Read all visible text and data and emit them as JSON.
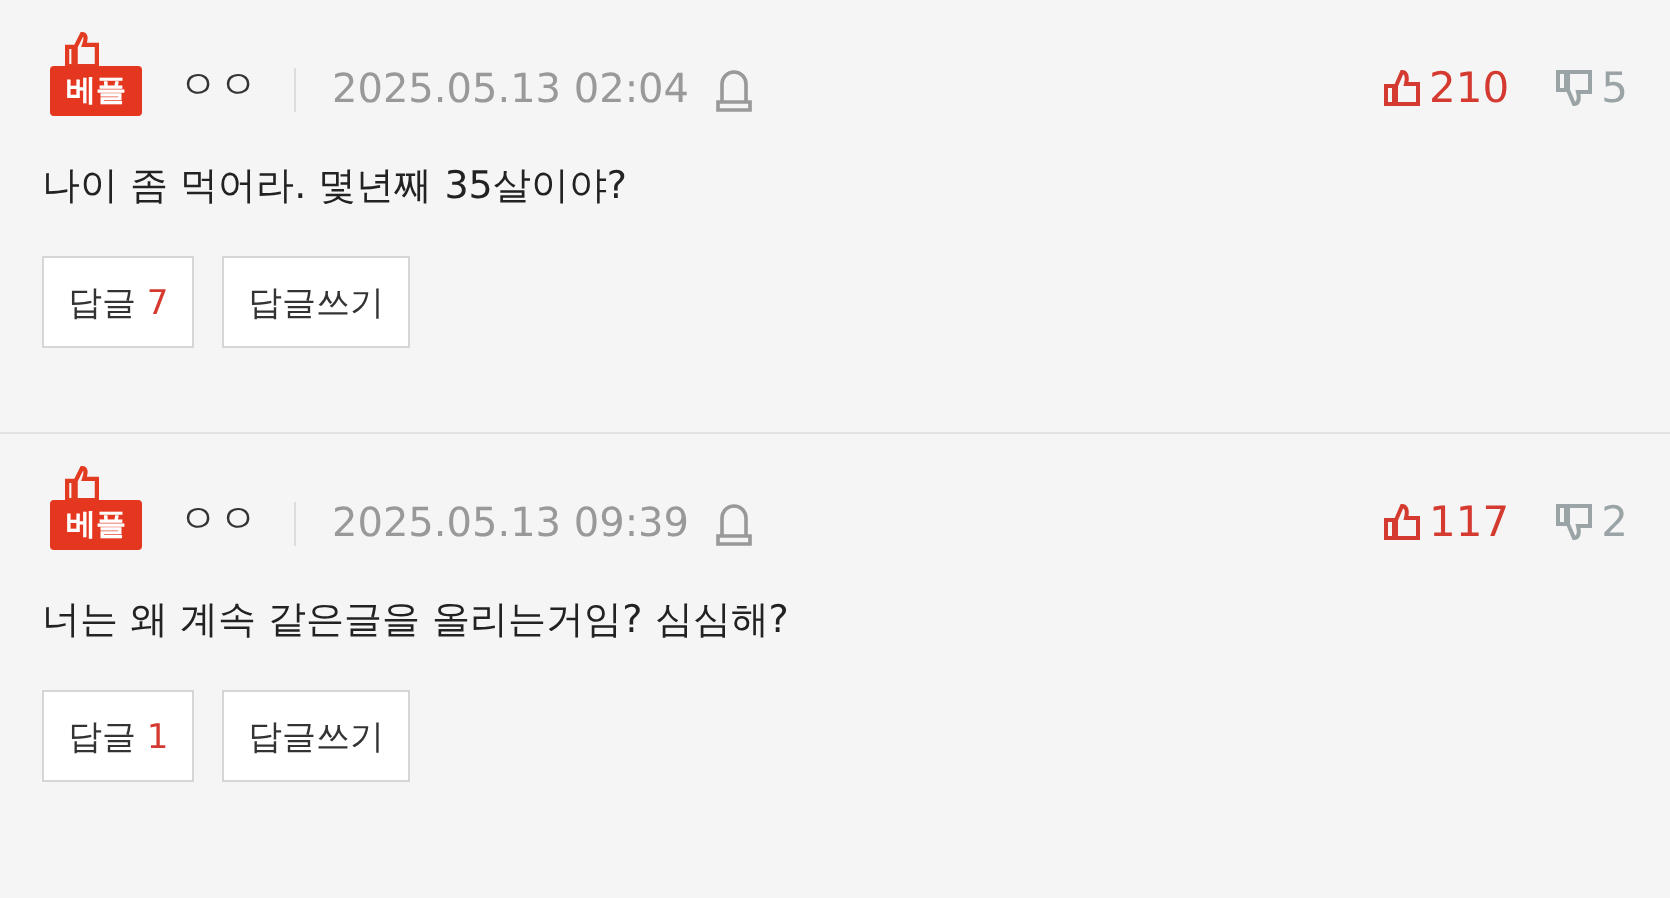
{
  "comments": [
    {
      "badge": "베플",
      "author": "ㅇㅇ",
      "date": "2025.05.13 02:04",
      "likes": "210",
      "dislikes": "5",
      "text": "나이 좀 먹어라. 몇년째 35살이야?",
      "reply_button": {
        "label": "답글",
        "count": "7"
      },
      "write_button": "답글쓰기"
    },
    {
      "badge": "베플",
      "author": "ㅇㅇ",
      "date": "2025.05.13 09:39",
      "likes": "117",
      "dislikes": "2",
      "text": "너는 왜 계속 같은글을 올리는거임? 심심해?",
      "reply_button": {
        "label": "답글",
        "count": "1"
      },
      "write_button": "답글쓰기"
    }
  ]
}
